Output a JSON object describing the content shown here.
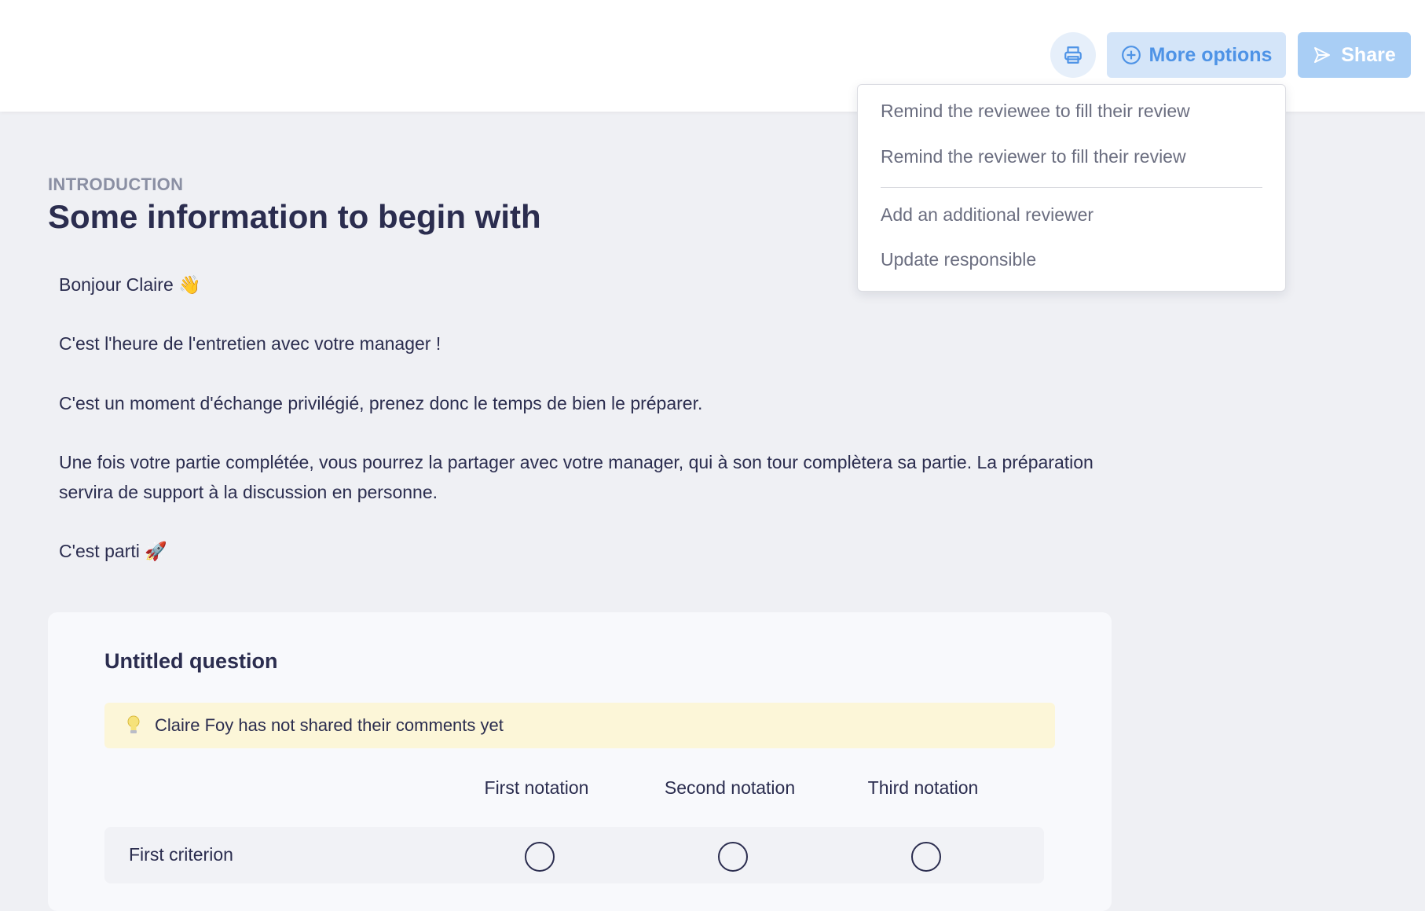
{
  "header": {
    "print_icon": "printer-icon",
    "more_options_label": "More options",
    "more_options_icon": "plus-circle-icon",
    "share_label": "Share",
    "share_icon": "send-icon",
    "colors": {
      "more_options_bg": "#d4e5f9",
      "more_options_text": "#4e93e6",
      "share_bg": "#a9cef5"
    }
  },
  "dropdown": {
    "items": [
      "Remind the reviewee to fill their review",
      "Remind the reviewer to fill their review",
      "Add an additional reviewer",
      "Update responsible"
    ]
  },
  "section": {
    "eyebrow": "INTRODUCTION",
    "title": "Some information to begin with",
    "paragraphs": [
      "Bonjour Claire 👋",
      "C'est l'heure de l'entretien avec votre manager !",
      "C'est un moment d'échange privilégié, prenez donc le temps de bien le préparer.",
      "Une fois votre partie complétée, vous pourrez la partager avec votre manager, qui à son tour complètera sa partie. La préparation servira de support à la discussion en personne.",
      "C'est parti 🚀"
    ]
  },
  "question": {
    "title": "Untitled question",
    "notice_icon": "lightbulb-icon",
    "notice_text": "Claire Foy has not shared their comments yet",
    "columns": [
      "First notation",
      "Second notation",
      "Third notation"
    ],
    "rows": [
      {
        "label": "First criterion"
      }
    ]
  }
}
